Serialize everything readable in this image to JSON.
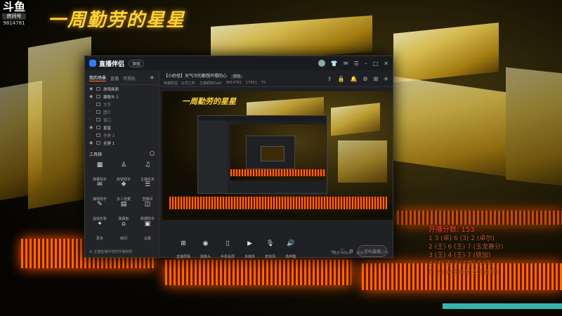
{
  "stream": {
    "logo_mark": "斗鱼",
    "logo_sub": "房间号",
    "room_id": "9814781",
    "title": "一周勤劳的星星"
  },
  "app": {
    "name": "直播伴侣",
    "badge": "旗舰",
    "window_icons": [
      "shirt-icon",
      "mail-icon",
      "menu-icon",
      "minimize-icon",
      "maximize-icon",
      "close-icon"
    ]
  },
  "sidebar": {
    "tabs": [
      "我的场景",
      "直播",
      "可视化"
    ],
    "scenes": [
      {
        "label": "游戏画面",
        "visible": true
      },
      {
        "label": "摄像头 1",
        "visible": true
      },
      {
        "label": "文字",
        "visible": false
      },
      {
        "label": "图片",
        "visible": false
      },
      {
        "label": "窗口",
        "visible": false
      },
      {
        "label": "星星",
        "visible": true
      },
      {
        "label": "全屏 2",
        "visible": false
      },
      {
        "label": "全屏 1",
        "visible": true
      }
    ],
    "tools_title": "工具箱",
    "tools": [
      {
        "icon": "▦",
        "label": "弹幕助手"
      },
      {
        "icon": "♙",
        "label": "房管助手"
      },
      {
        "icon": "♫",
        "label": "主播任务"
      },
      {
        "icon": "✉",
        "label": "抽奖助手"
      },
      {
        "icon": "❖",
        "label": "多人连麦"
      },
      {
        "icon": "☰",
        "label": "直播间"
      },
      {
        "icon": "✎",
        "label": "虚拟形象"
      },
      {
        "icon": "▤",
        "label": "弹幕板"
      },
      {
        "icon": "◫",
        "label": "数据助手"
      },
      {
        "icon": "✦",
        "label": "更多"
      },
      {
        "icon": "⌂",
        "label": "房间"
      },
      {
        "icon": "▣",
        "label": "设置"
      }
    ],
    "footer": "⚙ 主播直播中您的开播权限"
  },
  "room": {
    "title": "【小奶怪】天气冷的都想开摆的心",
    "tag": "修改",
    "category": "英雄联盟 · 云顶之弈",
    "anchor": "主播昵称DwD",
    "rid": "9814781",
    "hot": "17851",
    "fans": "75",
    "actions": [
      "share-icon",
      "lock-icon",
      "bell-icon",
      "settings-icon",
      "grid-icon",
      "ticket-icon"
    ]
  },
  "preview": {
    "title": "一周勤劳的星星"
  },
  "controls": {
    "items": [
      {
        "icon": "⊞",
        "label": "直播屏幕"
      },
      {
        "icon": "◉",
        "label": "摄像头"
      },
      {
        "icon": "▯",
        "label": "手机投屏"
      },
      {
        "icon": "▶",
        "label": "多媒体"
      },
      {
        "icon": "🎙",
        "label": "麦克风"
      },
      {
        "icon": "🔊",
        "label": "扬声器"
      }
    ],
    "go_live": "开始直播",
    "status": [
      "码率 0KB/s",
      "帧率 0",
      "CPU 22%"
    ]
  },
  "overlay": {
    "head": "开播分数: 153",
    "lines": [
      "1 3 (卓) 6 (3) 2 (卓尔)",
      "2 (王) 6 (王) 7 (玉龙赛分)",
      "3 (王) 4 (王) 7 (铁加)",
      "4 (4) 王 3 (4龙) 5 (王",
      "5 (4) (4王龙女 5.5龙神)"
    ]
  },
  "colors": {
    "accent": "#ff7a2e",
    "title_gold": "#ffd23a",
    "overlay_red": "#ff3b3b"
  }
}
